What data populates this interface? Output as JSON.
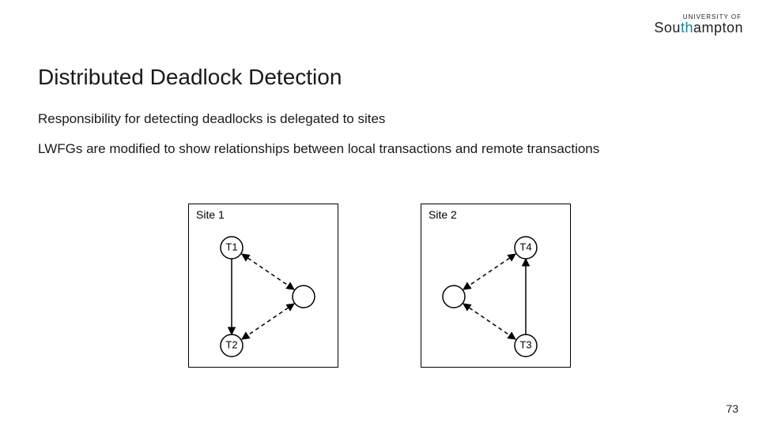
{
  "logo": {
    "top_line": "UNIVERSITY OF",
    "main_prefix": "Sou",
    "main_accent": "th",
    "main_suffix": "ampton"
  },
  "title": "Distributed Deadlock Detection",
  "paragraph1": "Responsibility for detecting deadlocks is delegated to sites",
  "paragraph2": "LWFGs are modified to show relationships between local transactions and remote transactions",
  "sites": {
    "site1": {
      "label": "Site 1",
      "node_top": "T1",
      "node_bottom": "T2"
    },
    "site2": {
      "label": "Site 2",
      "node_top": "T4",
      "node_bottom": "T3"
    }
  },
  "page_number": "73",
  "chart_data": {
    "type": "diagram",
    "description": "Two local wait-for graphs (LWFGs) for distributed deadlock detection",
    "sites": [
      {
        "name": "Site 1",
        "nodes": [
          "T1",
          "T2",
          "external"
        ],
        "edges": [
          {
            "from": "T1",
            "to": "T2",
            "style": "solid"
          },
          {
            "from": "T1",
            "to": "external",
            "style": "dashed"
          },
          {
            "from": "external",
            "to": "T1",
            "style": "dashed"
          },
          {
            "from": "external",
            "to": "T2",
            "style": "dashed"
          },
          {
            "from": "T2",
            "to": "external",
            "style": "dashed"
          }
        ]
      },
      {
        "name": "Site 2",
        "nodes": [
          "T4",
          "T3",
          "external"
        ],
        "edges": [
          {
            "from": "T3",
            "to": "T4",
            "style": "solid"
          },
          {
            "from": "T4",
            "to": "external",
            "style": "dashed"
          },
          {
            "from": "external",
            "to": "T4",
            "style": "dashed"
          },
          {
            "from": "external",
            "to": "T3",
            "style": "dashed"
          },
          {
            "from": "T3",
            "to": "external",
            "style": "dashed"
          }
        ]
      }
    ]
  }
}
